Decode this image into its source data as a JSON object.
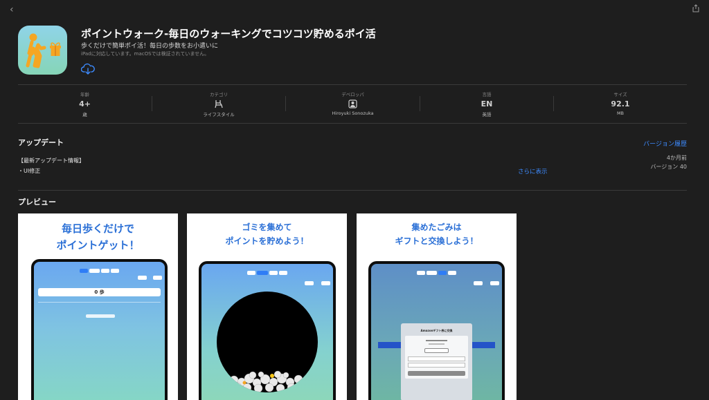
{
  "nav": {
    "back_icon": "chevron-left-icon",
    "share_icon": "share-icon"
  },
  "app": {
    "title": "ポイントウォーク-毎日のウォーキングでコツコツ貯めるポイ活",
    "subtitle": "歩くだけで簡単ポイ活！毎日の歩数をお小遣いに",
    "compatibility": "iPadに対応しています。macOSでは検証されていません。",
    "download_icon": "icloud-download-icon",
    "icon_name": "walking-person-gift-icon"
  },
  "stats": [
    {
      "label": "年齢",
      "value": "4+",
      "sub": "歳"
    },
    {
      "label": "カテゴリ",
      "value": "",
      "sub": "ライフスタイル",
      "icon": "chair-icon"
    },
    {
      "label": "デベロッパ",
      "value": "",
      "sub": "Hiroyuki Sonozuka",
      "icon": "person-icon"
    },
    {
      "label": "言語",
      "value": "EN",
      "sub": "英語"
    },
    {
      "label": "サイズ",
      "value": "92.1",
      "sub": "MB"
    }
  ],
  "updates": {
    "heading": "アップデート",
    "history_link": "バージョン履歴",
    "notes_title": "【最新アップデート情報】",
    "notes_item": "・UI修正",
    "more_link": "さらに表示",
    "time_ago": "4か月前",
    "version": "バージョン 40"
  },
  "preview": {
    "heading": "プレビュー",
    "screens": [
      {
        "caption_line1": "毎日歩くだけで",
        "caption_line2": "ポイントゲット！",
        "step_value": "0 歩"
      },
      {
        "caption_line1": "ゴミを集めて",
        "caption_line2": "ポイントを貯めよう！"
      },
      {
        "caption_line1": "集めたごみは",
        "caption_line2": "ギフトと交換しよう！",
        "dialog_title": "Amazonギフト券に交換"
      }
    ]
  },
  "colors": {
    "background": "#1e1e1e",
    "accent": "#3d8bff",
    "caption_blue": "#2a6fd6"
  }
}
